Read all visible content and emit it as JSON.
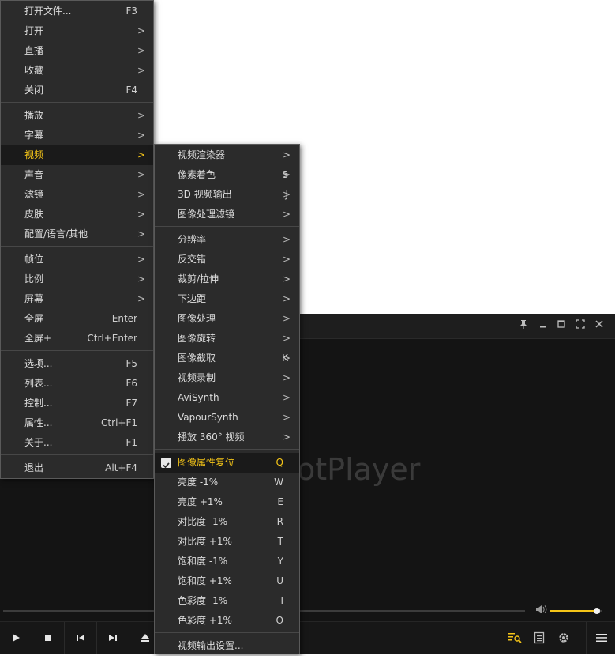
{
  "player": {
    "watermark": "otPlayer",
    "volume": 0.9
  },
  "main_menu": {
    "groups": [
      [
        {
          "label": "打开文件...",
          "shortcut": "F3",
          "submenu": false
        },
        {
          "label": "打开",
          "shortcut": "",
          "submenu": true
        },
        {
          "label": "直播",
          "shortcut": "",
          "submenu": true
        },
        {
          "label": "收藏",
          "shortcut": "",
          "submenu": true
        },
        {
          "label": "关闭",
          "shortcut": "F4",
          "submenu": false
        }
      ],
      [
        {
          "label": "播放",
          "shortcut": "",
          "submenu": true
        },
        {
          "label": "字幕",
          "shortcut": "",
          "submenu": true
        },
        {
          "label": "视频",
          "shortcut": "",
          "submenu": true,
          "active": true
        },
        {
          "label": "声音",
          "shortcut": "",
          "submenu": true
        },
        {
          "label": "滤镜",
          "shortcut": "",
          "submenu": true
        },
        {
          "label": "皮肤",
          "shortcut": "",
          "submenu": true
        },
        {
          "label": "配置/语言/其他",
          "shortcut": "",
          "submenu": true
        }
      ],
      [
        {
          "label": "帧位",
          "shortcut": "",
          "submenu": true
        },
        {
          "label": "比例",
          "shortcut": "",
          "submenu": true
        },
        {
          "label": "屏幕",
          "shortcut": "",
          "submenu": true
        },
        {
          "label": "全屏",
          "shortcut": "Enter",
          "submenu": false
        },
        {
          "label": "全屏+",
          "shortcut": "Ctrl+Enter",
          "submenu": false
        }
      ],
      [
        {
          "label": "选项...",
          "shortcut": "F5",
          "submenu": false
        },
        {
          "label": "列表...",
          "shortcut": "F6",
          "submenu": false
        },
        {
          "label": "控制...",
          "shortcut": "F7",
          "submenu": false
        },
        {
          "label": "属性...",
          "shortcut": "Ctrl+F1",
          "submenu": false
        },
        {
          "label": "关于...",
          "shortcut": "F1",
          "submenu": false
        }
      ],
      [
        {
          "label": "退出",
          "shortcut": "Alt+F4",
          "submenu": false
        }
      ]
    ]
  },
  "video_menu": {
    "groups": [
      [
        {
          "label": "视频渲染器",
          "shortcut": "",
          "submenu": true
        },
        {
          "label": "像素着色",
          "shortcut": "S",
          "submenu": true
        },
        {
          "label": "3D 视频输出",
          "shortcut": "J",
          "submenu": true
        },
        {
          "label": "图像处理滤镜",
          "shortcut": "",
          "submenu": true
        }
      ],
      [
        {
          "label": "分辨率",
          "shortcut": "",
          "submenu": true
        },
        {
          "label": "反交错",
          "shortcut": "",
          "submenu": true
        },
        {
          "label": "裁剪/拉伸",
          "shortcut": "",
          "submenu": true
        },
        {
          "label": "下边距",
          "shortcut": "",
          "submenu": true
        },
        {
          "label": "图像处理",
          "shortcut": "",
          "submenu": true
        },
        {
          "label": "图像旋转",
          "shortcut": "",
          "submenu": true
        },
        {
          "label": "图像截取",
          "shortcut": "K",
          "submenu": true
        },
        {
          "label": "视频录制",
          "shortcut": "",
          "submenu": true
        },
        {
          "label": "AviSynth",
          "shortcut": "",
          "submenu": true
        },
        {
          "label": "VapourSynth",
          "shortcut": "",
          "submenu": true
        },
        {
          "label": "播放 360° 视频",
          "shortcut": "",
          "submenu": true
        }
      ],
      [
        {
          "label": "图像属性复位",
          "shortcut": "Q",
          "submenu": false,
          "active": true,
          "checked": true
        },
        {
          "label": "亮度 -1%",
          "shortcut": "W",
          "submenu": false
        },
        {
          "label": "亮度 +1%",
          "shortcut": "E",
          "submenu": false
        },
        {
          "label": "对比度 -1%",
          "shortcut": "R",
          "submenu": false
        },
        {
          "label": "对比度 +1%",
          "shortcut": "T",
          "submenu": false
        },
        {
          "label": "饱和度 -1%",
          "shortcut": "Y",
          "submenu": false
        },
        {
          "label": "饱和度 +1%",
          "shortcut": "U",
          "submenu": false
        },
        {
          "label": "色彩度 -1%",
          "shortcut": "I",
          "submenu": false
        },
        {
          "label": "色彩度 +1%",
          "shortcut": "O",
          "submenu": false
        }
      ],
      [
        {
          "label": "视频输出设置...",
          "shortcut": "",
          "submenu": false
        }
      ]
    ]
  },
  "colors": {
    "accent": "#f5c518",
    "menu_bg": "#2b2b2b",
    "player_bg": "#141414"
  }
}
